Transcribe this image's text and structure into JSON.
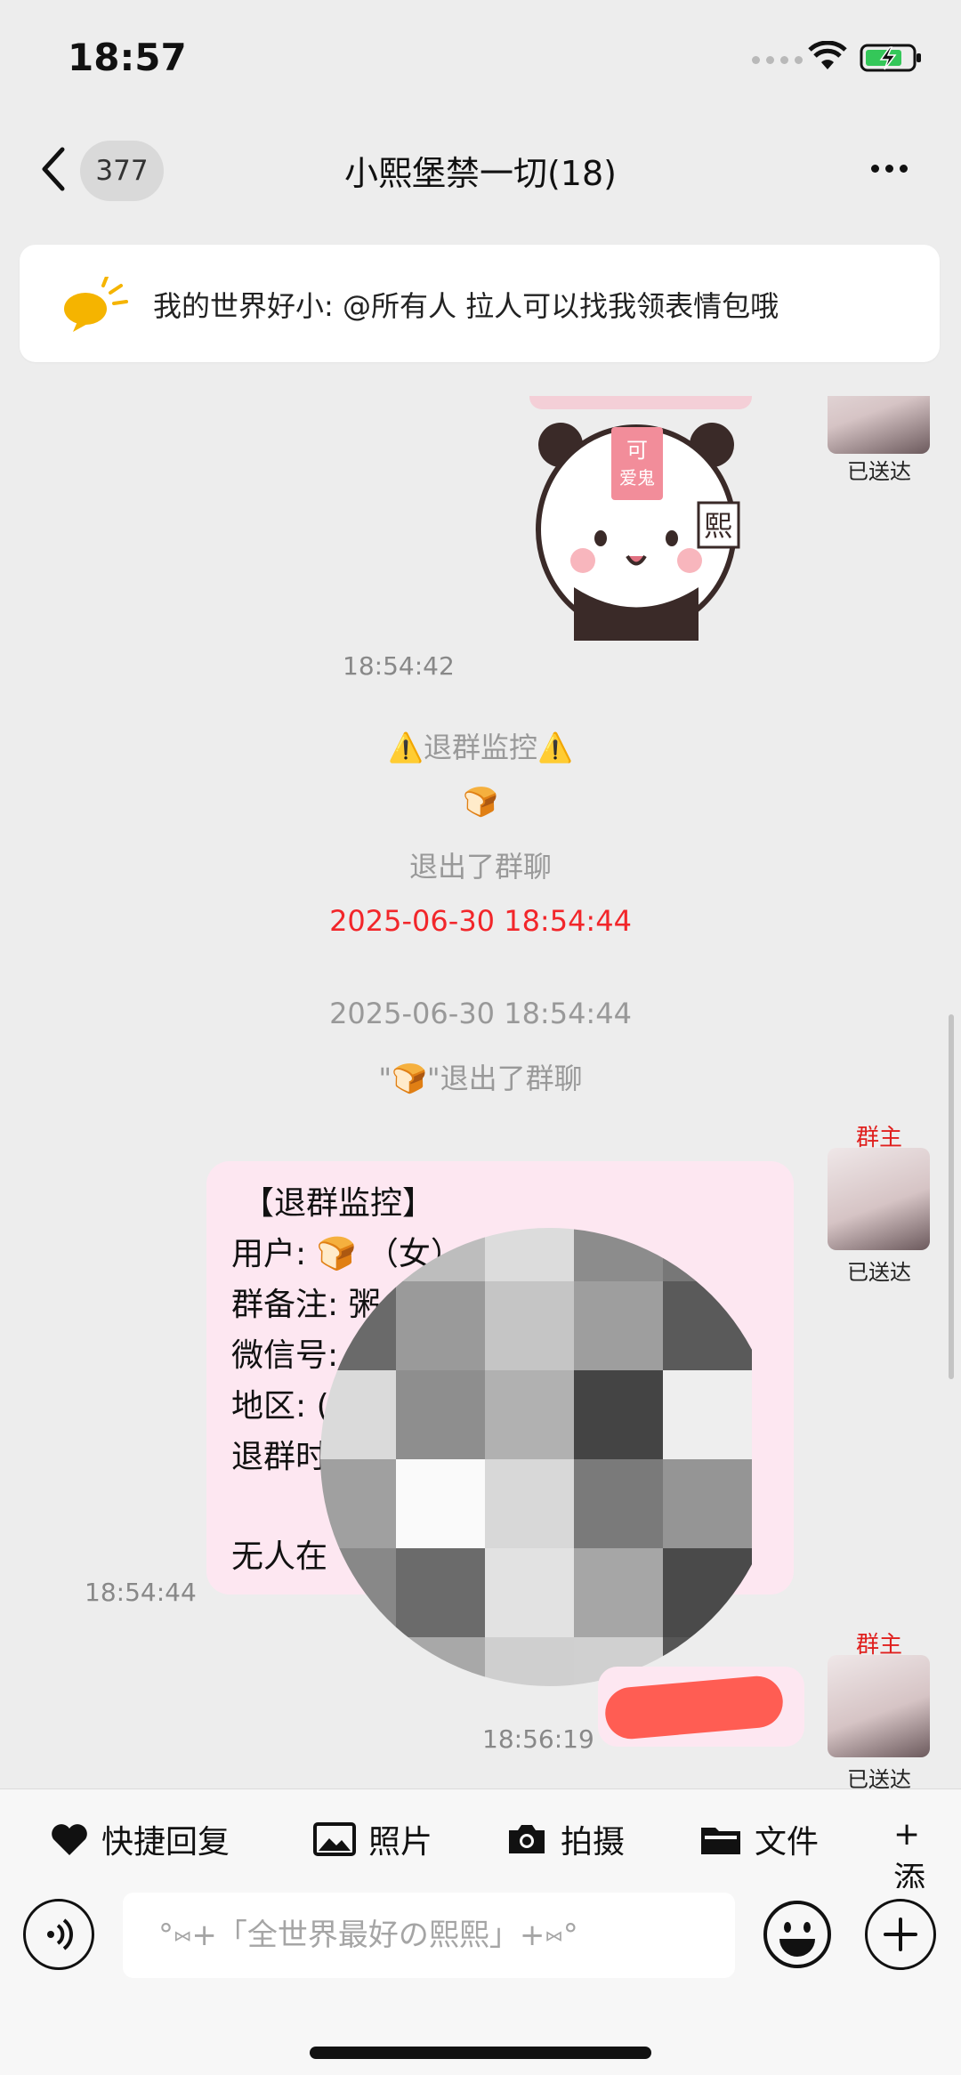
{
  "status_bar": {
    "time": "18:57"
  },
  "header": {
    "back_badge": "377",
    "title": "小熙堡禁一切(18)"
  },
  "announcement": {
    "text": "我的世界好小: @所有人 拉人可以找我领表情包哦"
  },
  "messages": {
    "sticker_time": "18:54:42",
    "sent_label": "已送达",
    "owner_label": "群主",
    "sys_monitor_title": "⚠️退群监控⚠️",
    "sys_bread": "🍞",
    "sys_left": "退出了群聊",
    "sys_red_time": "2025-06-30 18:54:44",
    "sys_gray_time": "2025-06-30 18:54:44",
    "sys_left_quote": "\"🍞\"退出了群聊",
    "card": {
      "title": "【退群监控】",
      "line1": "用户: 🍞 （女）",
      "line2": "群备注: 粥",
      "line3": "微信号:",
      "line4": "地区: (",
      "line5": "退群时",
      "line6": "无人在"
    },
    "card_time": "18:54:44",
    "last_time": "18:56:19"
  },
  "toolbar": {
    "quick_reply": "快捷回复",
    "photo": "照片",
    "camera": "拍摄",
    "file": "文件",
    "more": "+ 添"
  },
  "input": {
    "placeholder": "°⑅+「全世界最好の熙熙」+⑅°"
  },
  "colors": {
    "accent_red": "#f2262a",
    "pink_bubble": "#fde7f1",
    "scribble": "#ff5d53"
  }
}
